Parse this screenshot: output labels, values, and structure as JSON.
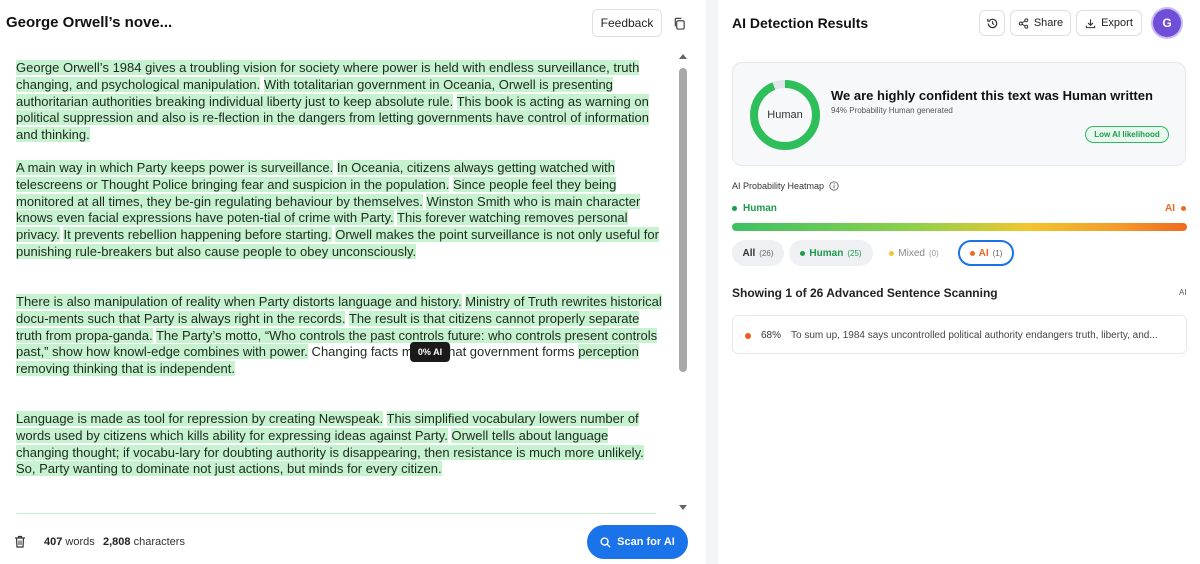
{
  "left": {
    "doc_title": "George Orwell’s nove...",
    "feedback_label": "Feedback",
    "paragraphs": [
      [
        {
          "t": "George Orwell’s 1984 gives a troubling vision for society where power is held with endless surveillance, truth changing, and psychological manipulation.",
          "h": true
        },
        {
          "t": " ",
          "h": false
        },
        {
          "t": "With totalitarian government in Oceania, Orwell is presenting authoritarian authorities breaking individual liberty just to keep absolute rule.",
          "h": true
        },
        {
          "t": " ",
          "h": false
        },
        {
          "t": "This book is acting as warning on political suppression and also is re-flection in the dangers from letting governments have control of information and thinking.",
          "h": true
        }
      ],
      [
        {
          "t": "A main way in which Party keeps power is surveillance.",
          "h": true
        },
        {
          "t": " ",
          "h": false
        },
        {
          "t": "In Oceania, citizens always getting watched with telescreens or Thought Police bringing fear and suspicion in the population.",
          "h": true
        },
        {
          "t": " ",
          "h": false
        },
        {
          "t": "Since people feel they being monitored at all times, they be-gin regulating behaviour by themselves.",
          "h": true
        },
        {
          "t": " ",
          "h": false
        },
        {
          "t": "Winston Smith who is main character knows even facial expressions have poten-tial of crime with Party.",
          "h": true
        },
        {
          "t": " ",
          "h": false
        },
        {
          "t": "This forever watching removes personal privacy.",
          "h": true
        },
        {
          "t": " ",
          "h": false
        },
        {
          "t": "It prevents rebellion happening before starting.",
          "h": true
        },
        {
          "t": " ",
          "h": false
        },
        {
          "t": "Orwell makes the point surveillance is not only useful for punishing rule-breakers but also cause people to obey unconsciously.",
          "h": true
        }
      ],
      [
        {
          "t": "There is also manipulation of reality when Party distorts language and history.",
          "h": true
        },
        {
          "t": " ",
          "h": false
        },
        {
          "t": "Ministry of Truth rewrites historical docu-ments such that Party is always right in the records.",
          "h": true
        },
        {
          "t": " ",
          "h": false
        },
        {
          "t": "The result is that citizens cannot properly separate truth from propa-ganda.",
          "h": true
        },
        {
          "t": " ",
          "h": false
        },
        {
          "t": "The Party’s motto, “Who controls the past controls future: who controls present controls past,” show how knowl-edge combines with power.",
          "h": true
        },
        {
          "t": " Changing facts means that government forms ",
          "h": false
        },
        {
          "t": "perception removing thinking that is independent.",
          "h": true
        }
      ],
      [
        {
          "t": "Language is made as tool for repression by creating Newspeak.",
          "h": true
        },
        {
          "t": " ",
          "h": false
        },
        {
          "t": "This simplified vocabulary lowers number of words used by citizens which kills ability for expressing ideas against Party.",
          "h": true
        },
        {
          "t": " ",
          "h": false
        },
        {
          "t": "Orwell tells about language changing thought; if vocabu-lary for doubting authority is disappearing, then resistance is much more unlikely.",
          "h": true
        },
        {
          "t": " ",
          "h": false
        },
        {
          "t": "So, Party wanting to dominate not just actions, but minds for every citizen.",
          "h": true
        }
      ]
    ],
    "tooltip": "0% AI",
    "words_count": "407",
    "words_label": "words",
    "chars_count": "2,808",
    "chars_label": "characters",
    "scan_label": "Scan for AI"
  },
  "right": {
    "title": "AI Detection Results",
    "share_label": "Share",
    "export_label": "Export",
    "avatar_letter": "G",
    "ring_label": "Human",
    "ring_fraction": 0.94,
    "confidence": "We are highly confident this text was Human written",
    "prob": "94% Probability Human generated",
    "likelihood": "Low AI likelihood",
    "heatmap_label": "AI Probability Heatmap",
    "legend_human": "Human",
    "legend_ai": "AI",
    "chips": {
      "all": {
        "label": "All",
        "count": "(26)"
      },
      "human": {
        "label": "Human",
        "count": "(25)"
      },
      "mixed": {
        "label": "Mixed",
        "count": "(0)"
      },
      "ai": {
        "label": "AI",
        "count": "(1)"
      }
    },
    "showing": "Showing 1 of 26 Advanced Sentence Scanning",
    "ai_tag": "AI",
    "sentence": {
      "pct": "68%",
      "text": "To sum up, 1984 says uncontrolled political authority endangers truth, liberty, and..."
    }
  },
  "colors": {
    "human_green": "#1d9a4d",
    "highlight": "#c7f2cf",
    "ai_orange": "#ef6a1f",
    "accent_blue": "#1a73e8"
  }
}
